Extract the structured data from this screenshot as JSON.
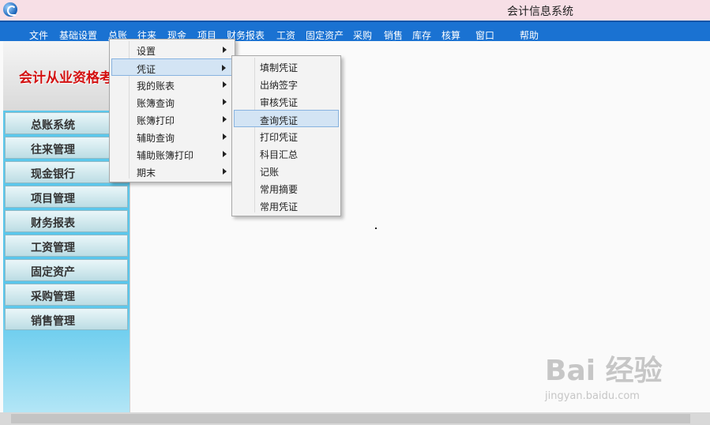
{
  "window": {
    "title": "会计信息系统"
  },
  "menubar": [
    "文件",
    "基础设置",
    "总账",
    "往来",
    "现金",
    "项目",
    "财务报表",
    "工资",
    "固定资产",
    "采购",
    "销售",
    "库存",
    "核算",
    "窗口",
    "帮助"
  ],
  "sidebar": {
    "banner": "会计从业资格考试",
    "items": [
      "总账系统",
      "往来管理",
      "现金银行",
      "项目管理",
      "财务报表",
      "工资管理",
      "固定资产",
      "采购管理",
      "销售管理"
    ]
  },
  "menu_zongzhang": {
    "items": [
      "设置",
      "凭证",
      "我的账表",
      "账簿查询",
      "账簿打印",
      "辅助查询",
      "辅助账簿打印",
      "期末"
    ],
    "highlighted": "凭证"
  },
  "menu_pingzheng": {
    "items": [
      "填制凭证",
      "出纳签字",
      "审核凭证",
      "查询凭证",
      "打印凭证",
      "科目汇总",
      "记账",
      "常用摘要",
      "常用凭证"
    ],
    "highlighted": "查询凭证"
  },
  "watermark": {
    "brand": "Bai 经验",
    "url": "jingyan.baidu.com"
  }
}
